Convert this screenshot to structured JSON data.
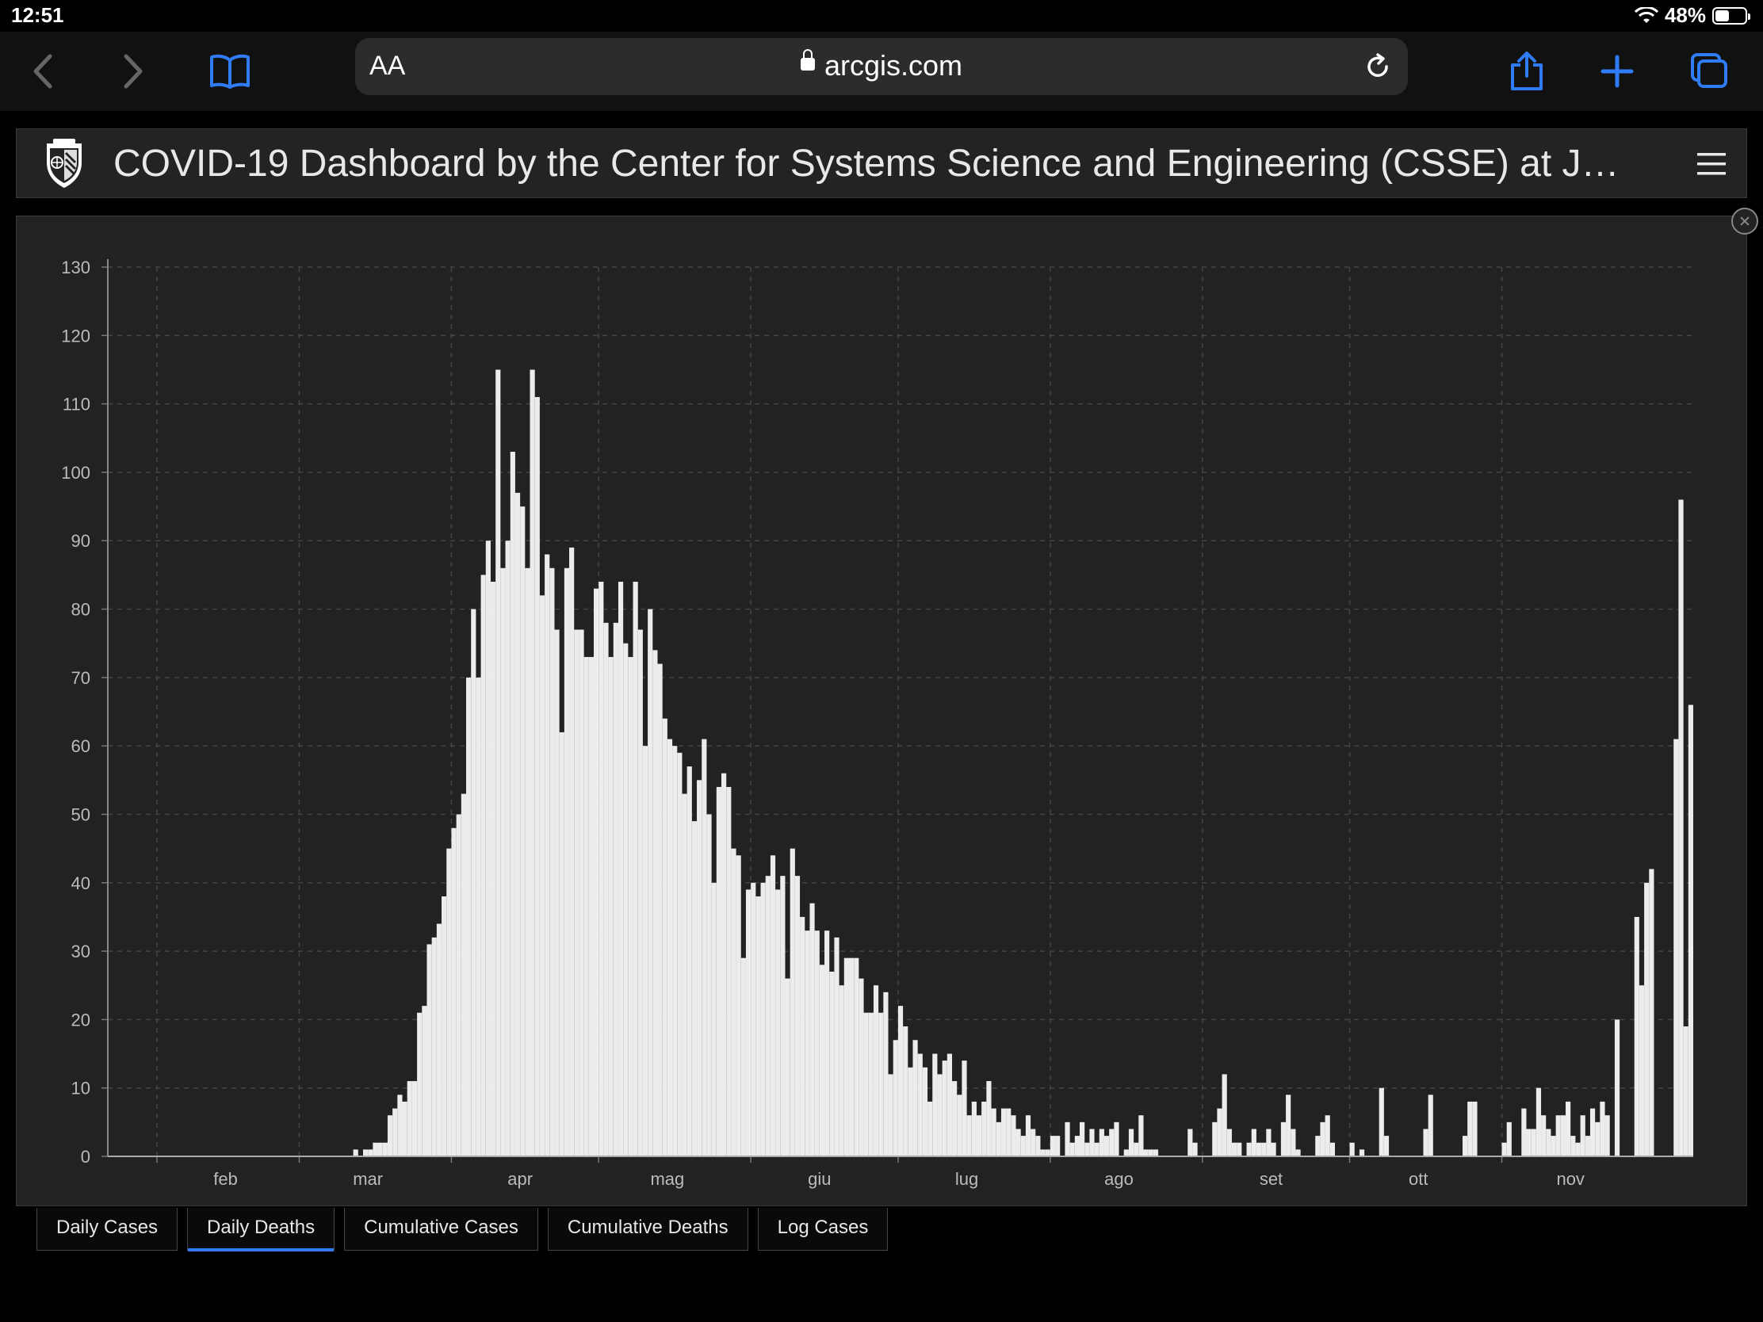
{
  "status": {
    "time": "12:51",
    "battery": "48%",
    "battery_level": 0.48
  },
  "browser": {
    "text_size_label": "AA",
    "url": "arcgis.com"
  },
  "icons": {
    "back": "chevron-left-icon",
    "forward": "chevron-right-icon",
    "bookmarks": "book-icon",
    "reload": "reload-icon",
    "share": "share-icon",
    "new_tab": "plus-icon",
    "tabs": "tabs-icon",
    "wifi": "wifi-icon",
    "lock": "lock-icon",
    "menu": "hamburger-menu-icon",
    "collapse": "collapse-icon"
  },
  "dashboard": {
    "title": "COVID-19 Dashboard by the Center for Systems Science and Engineering (CSSE) at J…"
  },
  "colors": {
    "accent": "#2f7cf6",
    "bar": "#ececec",
    "panel": "#222222"
  },
  "tabs": [
    {
      "label": "Daily Cases",
      "active": false
    },
    {
      "label": "Daily Deaths",
      "active": true
    },
    {
      "label": "Cumulative Cases",
      "active": false
    },
    {
      "label": "Cumulative Deaths",
      "active": false
    },
    {
      "label": "Log Cases",
      "active": false
    }
  ],
  "chart_data": {
    "type": "bar",
    "title": "",
    "xlabel": "",
    "ylabel": "",
    "ylim": [
      0,
      130
    ],
    "yticks": [
      0,
      10,
      20,
      30,
      40,
      50,
      60,
      70,
      80,
      90,
      100,
      110,
      120,
      130
    ],
    "xtick_labels": [
      "feb",
      "mar",
      "apr",
      "mag",
      "giu",
      "lug",
      "ago",
      "set",
      "ott",
      "nov"
    ],
    "x_start": "2020-01-22",
    "grid": true,
    "values": [
      0,
      0,
      0,
      0,
      0,
      0,
      0,
      0,
      0,
      0,
      0,
      0,
      0,
      0,
      0,
      0,
      0,
      0,
      0,
      0,
      0,
      0,
      0,
      0,
      0,
      0,
      0,
      0,
      0,
      0,
      0,
      0,
      0,
      0,
      0,
      0,
      0,
      0,
      0,
      0,
      0,
      0,
      0,
      0,
      0,
      0,
      0,
      0,
      0,
      0,
      1,
      0,
      1,
      1,
      2,
      2,
      2,
      6,
      7,
      9,
      8,
      11,
      11,
      21,
      22,
      31,
      32,
      34,
      38,
      45,
      48,
      50,
      53,
      70,
      80,
      70,
      85,
      90,
      84,
      115,
      86,
      90,
      103,
      97,
      95,
      86,
      115,
      111,
      82,
      88,
      86,
      77,
      62,
      86,
      89,
      77,
      77,
      73,
      73,
      83,
      84,
      78,
      73,
      78,
      84,
      75,
      73,
      84,
      77,
      60,
      80,
      74,
      72,
      64,
      61,
      60,
      59,
      53,
      57,
      49,
      55,
      61,
      50,
      40,
      54,
      56,
      54,
      45,
      44,
      29,
      39,
      40,
      38,
      40,
      41,
      44,
      39,
      41,
      26,
      45,
      41,
      35,
      33,
      37,
      33,
      28,
      33,
      27,
      32,
      25,
      29,
      29,
      29,
      26,
      21,
      21,
      25,
      21,
      24,
      12,
      17,
      22,
      19,
      13,
      17,
      15,
      13,
      8,
      15,
      12,
      14,
      15,
      11,
      9,
      14,
      6,
      8,
      6,
      8,
      11,
      7,
      5,
      7,
      7,
      6,
      4,
      3,
      6,
      4,
      3,
      1,
      1,
      3,
      3,
      0,
      5,
      2,
      3,
      5,
      2,
      4,
      2,
      4,
      3,
      4,
      5,
      0,
      1,
      4,
      2,
      6,
      1,
      1,
      1,
      0,
      0,
      0,
      0,
      0,
      0,
      4,
      2,
      0,
      0,
      0,
      5,
      7,
      12,
      4,
      2,
      2,
      0,
      2,
      4,
      2,
      2,
      4,
      2,
      0,
      5,
      9,
      4,
      1,
      0,
      0,
      0,
      3,
      5,
      6,
      2,
      0,
      0,
      0,
      2,
      0,
      1,
      0,
      0,
      0,
      10,
      3,
      0,
      0,
      0,
      0,
      0,
      0,
      0,
      4,
      9,
      0,
      0,
      0,
      0,
      0,
      0,
      3,
      8,
      8,
      0,
      0,
      0,
      0,
      0,
      2,
      5,
      0,
      0,
      7,
      4,
      4,
      10,
      6,
      4,
      3,
      6,
      6,
      8,
      3,
      2,
      6,
      3,
      7,
      5,
      8,
      6,
      0,
      20,
      0,
      0,
      0,
      35,
      25,
      40,
      42,
      0,
      0,
      0,
      0,
      61,
      96,
      19,
      66
    ]
  }
}
